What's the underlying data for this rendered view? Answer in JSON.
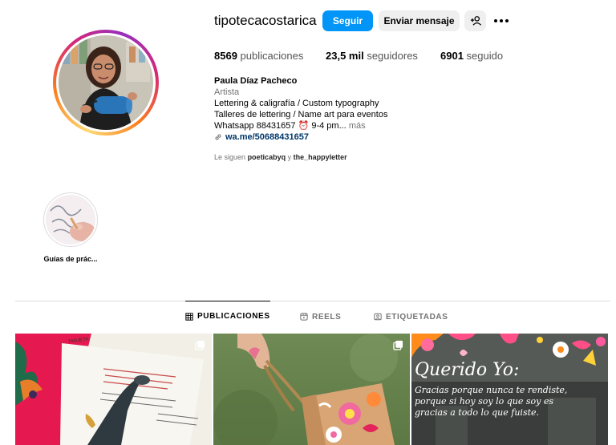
{
  "profile": {
    "username": "tipotecacostarica",
    "buttons": {
      "follow": "Seguir",
      "message": "Enviar mensaje"
    },
    "stats": [
      {
        "value": "8569",
        "label": "publicaciones"
      },
      {
        "value": "23,5 mil",
        "label": "seguidores"
      },
      {
        "value": "6901",
        "label": "seguido"
      }
    ],
    "bio": {
      "name": "Paula Díaz Pacheco",
      "category": "Artista",
      "lines": [
        "Lettering & caligrafía / Custom typography",
        "Talleres de lettering / Name art para eventos"
      ],
      "truncated_line": "Whatsapp 88431657 ⏰ 9-4 pm...",
      "more": "más",
      "link": "wa.me/50688431657"
    },
    "followed_by": {
      "prefix": "Le siguen",
      "user1": "poeticabyq",
      "conj": "y",
      "user2": "the_happyletter"
    }
  },
  "highlights": [
    {
      "label": "Guías de prác..."
    }
  ],
  "tabs": [
    {
      "label": "PUBLICACIONES",
      "active": true
    },
    {
      "label": "REELS",
      "active": false
    },
    {
      "label": "ETIQUETADAS",
      "active": false
    }
  ],
  "posts": [
    {
      "multi": true
    },
    {
      "multi": true
    },
    {
      "multi": false,
      "text_line1": "Querido Yo:",
      "text_line2": "Gracias porque nunca te rendiste,",
      "text_line3": "porque si hoy soy lo que soy es",
      "text_line4": "gracias a todo lo que fuiste."
    }
  ],
  "colors": {
    "accent": "#0095f6",
    "link": "#00376b",
    "secondary_text": "#737373",
    "divider": "#dbdbdb"
  }
}
